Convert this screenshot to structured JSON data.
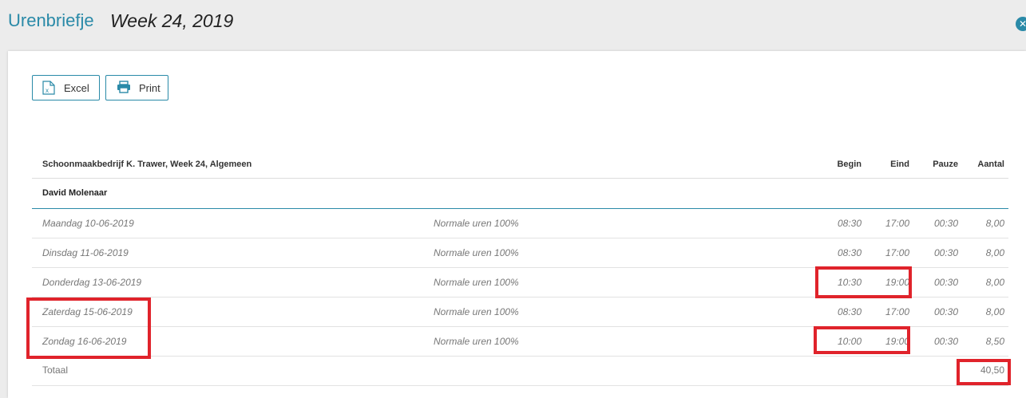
{
  "header": {
    "title": "Urenbriefje",
    "week": "Week 24, 2019",
    "close_icon": "close-circle-icon"
  },
  "toolbar": {
    "excel_label": "Excel",
    "excel_icon": "excel-file-icon",
    "print_label": "Print",
    "print_icon": "printer-icon"
  },
  "table": {
    "title": "Schoonmaakbedrijf K. Trawer, Week 24, Algemeen",
    "columns": {
      "begin": "Begin",
      "eind": "Eind",
      "pauze": "Pauze",
      "aantal": "Aantal"
    },
    "person": "David Molenaar",
    "rows": [
      {
        "day": "Maandag 10-06-2019",
        "type": "Normale uren 100%",
        "begin": "08:30",
        "eind": "17:00",
        "pauze": "00:30",
        "aantal": "8,00"
      },
      {
        "day": "Dinsdag 11-06-2019",
        "type": "Normale uren 100%",
        "begin": "08:30",
        "eind": "17:00",
        "pauze": "00:30",
        "aantal": "8,00"
      },
      {
        "day": "Donderdag 13-06-2019",
        "type": "Normale uren 100%",
        "begin": "10:30",
        "eind": "19:00",
        "pauze": "00:30",
        "aantal": "8,00"
      },
      {
        "day": "Zaterdag 15-06-2019",
        "type": "Normale uren 100%",
        "begin": "08:30",
        "eind": "17:00",
        "pauze": "00:30",
        "aantal": "8,00"
      },
      {
        "day": "Zondag 16-06-2019",
        "type": "Normale uren 100%",
        "begin": "10:00",
        "eind": "19:00",
        "pauze": "00:30",
        "aantal": "8,50"
      }
    ],
    "total_label": "Totaal",
    "total_value": "40,50"
  },
  "colors": {
    "accent": "#2a8aa8",
    "highlight": "#e0232b"
  }
}
